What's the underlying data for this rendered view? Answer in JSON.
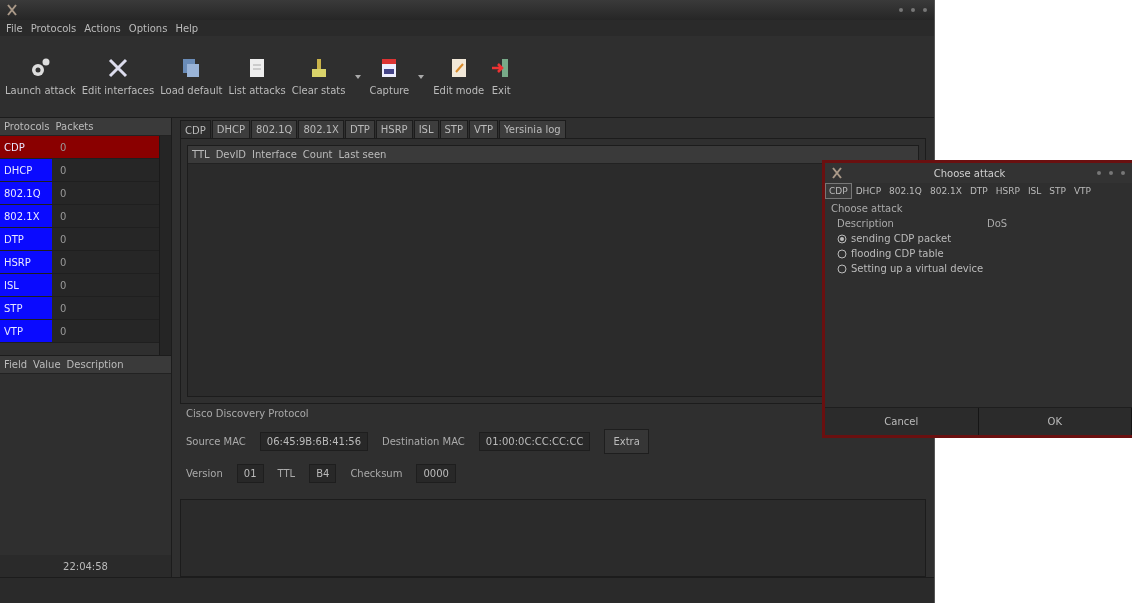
{
  "menu": [
    "File",
    "Protocols",
    "Actions",
    "Options",
    "Help"
  ],
  "toolbar": [
    {
      "label": "Launch attack",
      "has_menu": false
    },
    {
      "label": "Edit interfaces",
      "has_menu": false
    },
    {
      "label": "Load default",
      "has_menu": false
    },
    {
      "label": "List attacks",
      "has_menu": false
    },
    {
      "label": "Clear stats",
      "has_menu": true
    },
    {
      "label": "Capture",
      "has_menu": true
    },
    {
      "label": "Edit mode",
      "has_menu": false
    },
    {
      "label": "Exit",
      "has_menu": false
    }
  ],
  "protocols": {
    "columns": [
      "Protocols",
      "Packets"
    ],
    "rows": [
      {
        "name": "CDP",
        "packets": "0",
        "selected": true
      },
      {
        "name": "DHCP",
        "packets": "0",
        "selected": false
      },
      {
        "name": "802.1Q",
        "packets": "0",
        "selected": false
      },
      {
        "name": "802.1X",
        "packets": "0",
        "selected": false
      },
      {
        "name": "DTP",
        "packets": "0",
        "selected": false
      },
      {
        "name": "HSRP",
        "packets": "0",
        "selected": false
      },
      {
        "name": "ISL",
        "packets": "0",
        "selected": false
      },
      {
        "name": "STP",
        "packets": "0",
        "selected": false
      },
      {
        "name": "VTP",
        "packets": "0",
        "selected": false
      }
    ]
  },
  "fields": {
    "columns": [
      "Field",
      "Value",
      "Description"
    ]
  },
  "clock": "22:04:58",
  "tabs": [
    {
      "label": "CDP",
      "selected": true
    },
    {
      "label": "DHCP",
      "selected": false
    },
    {
      "label": "802.1Q",
      "selected": false
    },
    {
      "label": "802.1X",
      "selected": false
    },
    {
      "label": "DTP",
      "selected": false
    },
    {
      "label": "HSRP",
      "selected": false
    },
    {
      "label": "ISL",
      "selected": false
    },
    {
      "label": "STP",
      "selected": false
    },
    {
      "label": "VTP",
      "selected": false
    },
    {
      "label": "Yersinia log",
      "selected": false
    }
  ],
  "table": {
    "columns": [
      "TTL",
      "DevID",
      "Interface",
      "Count",
      "Last seen"
    ]
  },
  "details": {
    "title": "Cisco Discovery Protocol",
    "source_mac": {
      "label": "Source MAC",
      "value": "06:45:9B:6B:41:56"
    },
    "destination_mac": {
      "label": "Destination MAC",
      "value": "01:00:0C:CC:CC:CC"
    },
    "version": {
      "label": "Version",
      "value": "01"
    },
    "ttl": {
      "label": "TTL",
      "value": "B4"
    },
    "checksum": {
      "label": "Checksum",
      "value": "0000"
    },
    "extra_button": "Extra"
  },
  "dialog": {
    "title": "Choose attack",
    "tabs": [
      {
        "label": "CDP",
        "selected": true
      },
      {
        "label": "DHCP",
        "selected": false
      },
      {
        "label": "802.1Q",
        "selected": false
      },
      {
        "label": "802.1X",
        "selected": false
      },
      {
        "label": "DTP",
        "selected": false
      },
      {
        "label": "HSRP",
        "selected": false
      },
      {
        "label": "ISL",
        "selected": false
      },
      {
        "label": "STP",
        "selected": false
      },
      {
        "label": "VTP",
        "selected": false
      }
    ],
    "heading": "Choose attack",
    "columns": [
      "Description",
      "DoS"
    ],
    "options": [
      {
        "label": "sending CDP packet",
        "selected": true
      },
      {
        "label": "flooding CDP table",
        "selected": false
      },
      {
        "label": "Setting up a virtual device",
        "selected": false
      }
    ],
    "buttons": [
      "Cancel",
      "OK"
    ]
  }
}
